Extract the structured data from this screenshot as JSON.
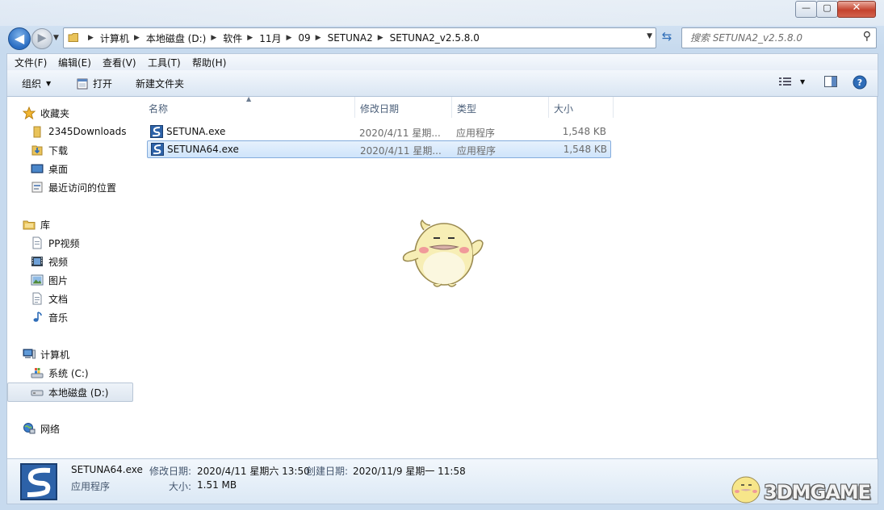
{
  "address": {
    "crumbs": [
      "计算机",
      "本地磁盘 (D:)",
      "软件",
      "11月",
      "09",
      "SETUNA2",
      "SETUNA2_v2.5.8.0"
    ]
  },
  "search": {
    "placeholder": "搜索 SETUNA2_v2.5.8.0"
  },
  "menu": [
    "文件(F)",
    "编辑(E)",
    "查看(V)",
    "工具(T)",
    "帮助(H)"
  ],
  "toolbar": {
    "organize": "组织",
    "open": "打开",
    "new_folder": "新建文件夹"
  },
  "sidebar": {
    "favorites": {
      "label": "收藏夹",
      "items": [
        "2345Downloads",
        "下载",
        "桌面",
        "最近访问的位置"
      ]
    },
    "libraries": {
      "label": "库",
      "items": [
        "PP视频",
        "视频",
        "图片",
        "文档",
        "音乐"
      ]
    },
    "computer": {
      "label": "计算机",
      "items": [
        "系统 (C:)",
        "本地磁盘 (D:)"
      ]
    },
    "network": {
      "label": "网络"
    }
  },
  "columns": [
    "名称",
    "修改日期",
    "类型",
    "大小"
  ],
  "files": [
    {
      "name": "SETUNA.exe",
      "date": "2020/4/11 星期...",
      "type": "应用程序",
      "size": "1,548 KB",
      "selected": false
    },
    {
      "name": "SETUNA64.exe",
      "date": "2020/4/11 星期...",
      "type": "应用程序",
      "size": "1,548 KB",
      "selected": true
    }
  ],
  "details": {
    "filename": "SETUNA64.exe",
    "modified_label": "修改日期:",
    "modified_value": "2020/4/11 星期六 13:50",
    "created_label": "创建日期:",
    "created_value": "2020/11/9 星期一 11:58",
    "type": "应用程序",
    "size_label": "大小:",
    "size_value": "1.51 MB"
  },
  "watermark": "3DMGAME",
  "colors": {
    "accent": "#2a6dc2",
    "selection": "#cfe4fb",
    "selection_border": "#84acdd"
  }
}
